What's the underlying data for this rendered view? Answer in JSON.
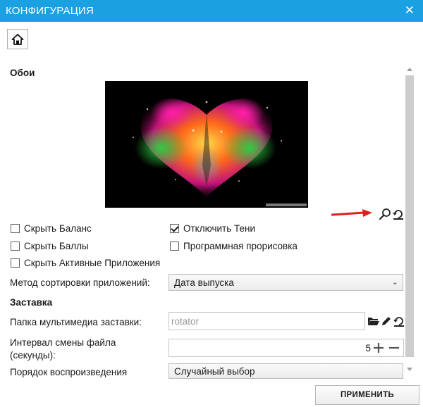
{
  "window": {
    "title": "КОНФИГУРАЦИЯ",
    "close_glyph": "✕"
  },
  "wallpaper_section": {
    "title": "Обои",
    "image_name": "colorful-heart-wallpaper"
  },
  "checkboxes": [
    {
      "label": "Скрыть Баланс",
      "checked": false
    },
    {
      "label": "Отключить Тени",
      "checked": true
    },
    {
      "label": "Скрыть Баллы",
      "checked": false
    },
    {
      "label": "Программная прорисовка",
      "checked": false
    },
    {
      "label": "Скрыть Активные Приложения",
      "checked": false
    }
  ],
  "sort": {
    "label": "Метод сортировки приложений:",
    "value": "Дата выпуска"
  },
  "screensaver": {
    "title": "Заставка",
    "folder_label": "Папка мультимедиа заставки:",
    "folder_value": "rotator",
    "interval_label": "Интервал смены файла (секунды):",
    "interval_value": "5",
    "order_label": "Порядок воспроизведения",
    "order_value": "Случайный выбор"
  },
  "footer": {
    "apply_label": "ПРИМЕНИТЬ"
  },
  "colors": {
    "titlebar": "#1ba1e2",
    "annotation_arrow": "#e0201b"
  }
}
